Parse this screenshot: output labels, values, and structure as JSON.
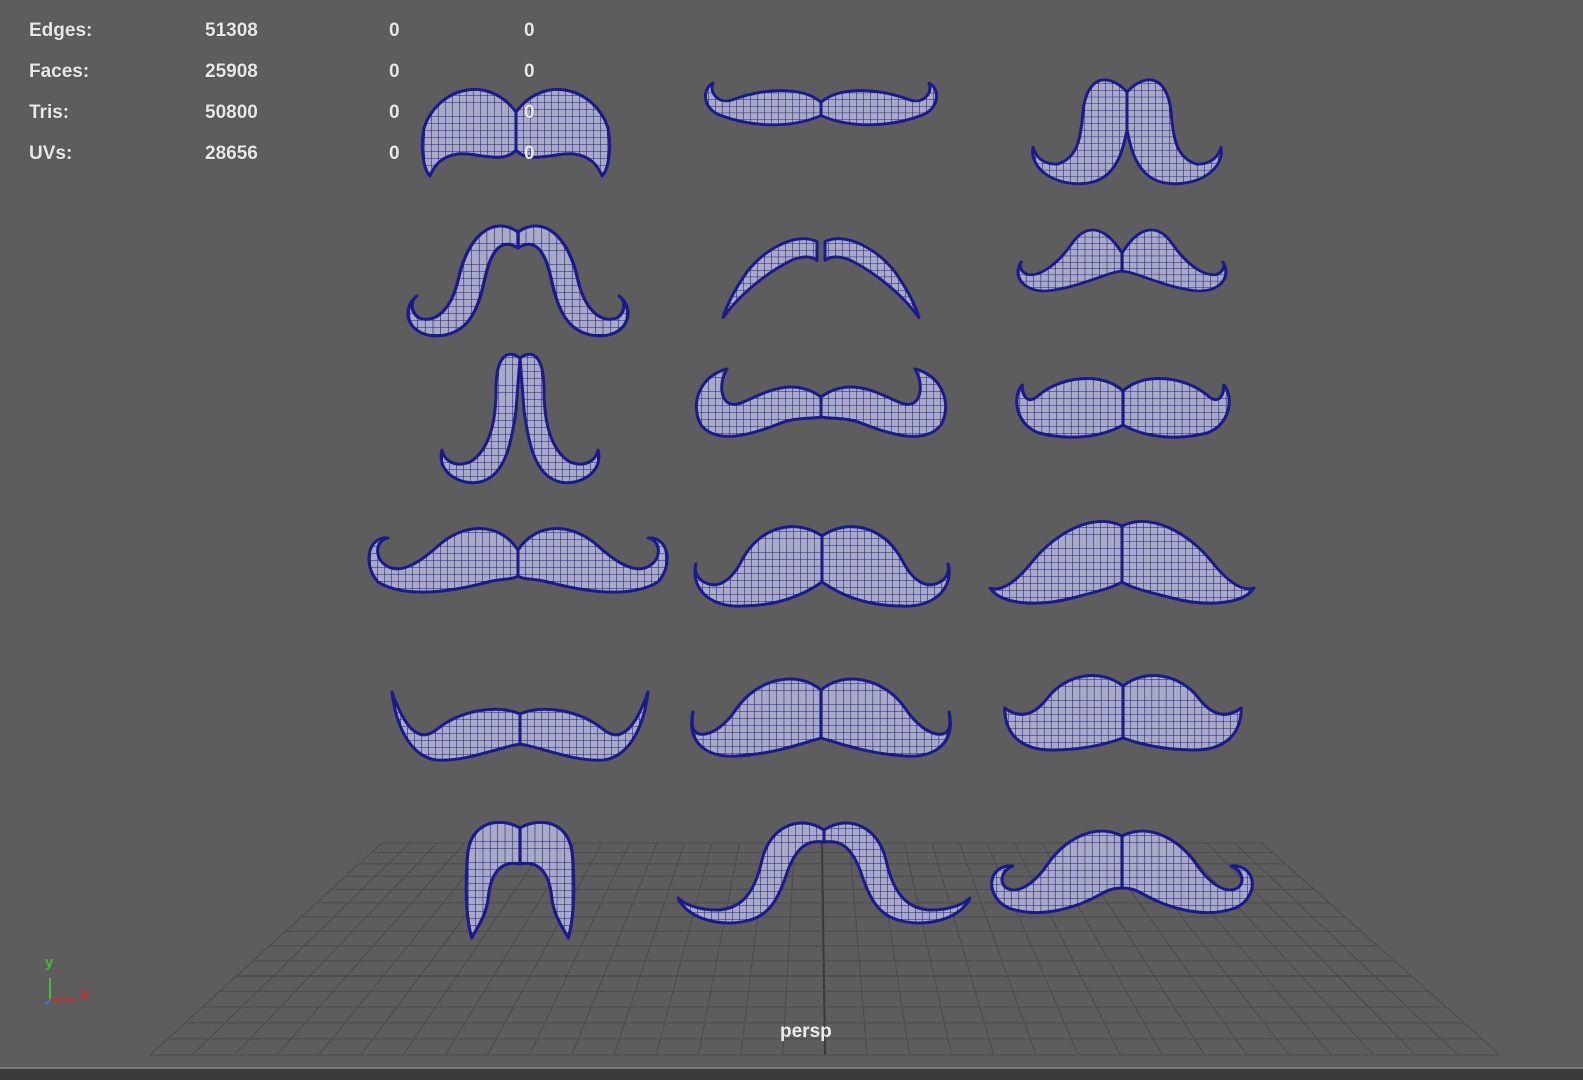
{
  "hud": {
    "rows": [
      {
        "label": "Edges:",
        "values": [
          "51308",
          "0",
          "0"
        ]
      },
      {
        "label": "Faces:",
        "values": [
          "25908",
          "0",
          "0"
        ]
      },
      {
        "label": "Tris:",
        "values": [
          "50800",
          "0",
          "0"
        ]
      },
      {
        "label": "UVs:",
        "values": [
          "28656",
          "0",
          "0"
        ]
      }
    ]
  },
  "viewport": {
    "camera": "persp"
  },
  "axis": {
    "y_label": "y",
    "x_label": "x"
  },
  "colors": {
    "background": "#5d5d5d",
    "wireframe": "#1a1a8c",
    "mesh_fill": "#a9aac3",
    "grid": "#4a4a4a",
    "hud_text": "#e8e8e8",
    "axis_y": "#39c239",
    "axis_x": "#d42a2a",
    "axis_z": "#3e6fe0"
  },
  "scene": {
    "object_count": 18,
    "object_type": "mustache-mesh"
  }
}
